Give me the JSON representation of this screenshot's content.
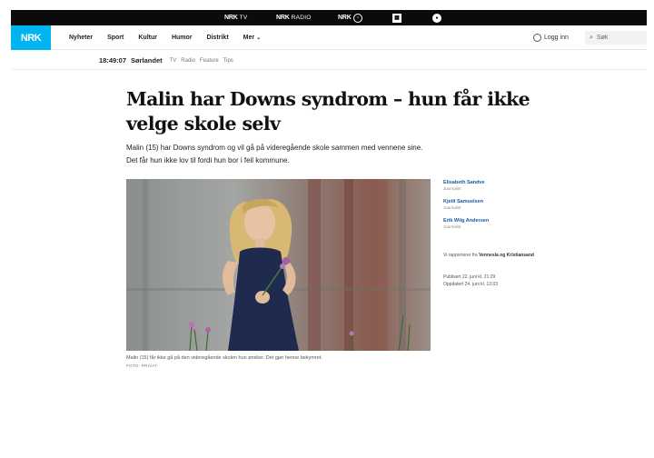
{
  "service_bar": {
    "items": [
      {
        "brand": "NRK",
        "sub": "TV"
      },
      {
        "brand": "NRK",
        "sub": "RADIO"
      },
      {
        "brand": "NRK",
        "sub": ""
      },
      {
        "brand": "",
        "sub": ""
      },
      {
        "brand": "",
        "sub": ""
      }
    ]
  },
  "header": {
    "logo": "NRK",
    "nav": [
      "Nyheter",
      "Sport",
      "Kultur",
      "Humor",
      "Distrikt",
      "Mer"
    ],
    "login_label": "Logg inn",
    "search_placeholder": "Søk"
  },
  "subheader": {
    "time": "18:49:07",
    "region": "Sørlandet",
    "links": [
      "TV",
      "Radio",
      "Feature",
      "Tips"
    ]
  },
  "article": {
    "headline": "Malin har Downs syndrom – hun får ikke velge skole selv",
    "lead": "Malin (15) har Downs syndrom og vil gå på videregående skole sammen med vennene sine. Det får hun ikke lov til fordi hun bor i feil kommune.",
    "caption": "Malin (15) får ikke gå på den videregående skolen hun ønsker. Det gjør henne bekymret.",
    "credit": "FOTO: PRIVAT"
  },
  "bylines": [
    {
      "name": "Elisabeth Sandve",
      "role": "Journalist"
    },
    {
      "name": "Kjetil Samuelsen",
      "role": "Journalist"
    },
    {
      "name": "Erik Wiig Andersen",
      "role": "Journalist"
    }
  ],
  "meta": {
    "report_prefix": "Vi rapporterer fra",
    "report_place": "Vennesla og Kristiansand",
    "published": "Publisert 22. juni kl. 21:29",
    "updated": "Oppdatert 24. juni kl. 13:03"
  },
  "colors": {
    "brand_blue": "#00b4f0",
    "byline_blue": "#1a5aa6",
    "topbar": "#0b0b0b"
  }
}
